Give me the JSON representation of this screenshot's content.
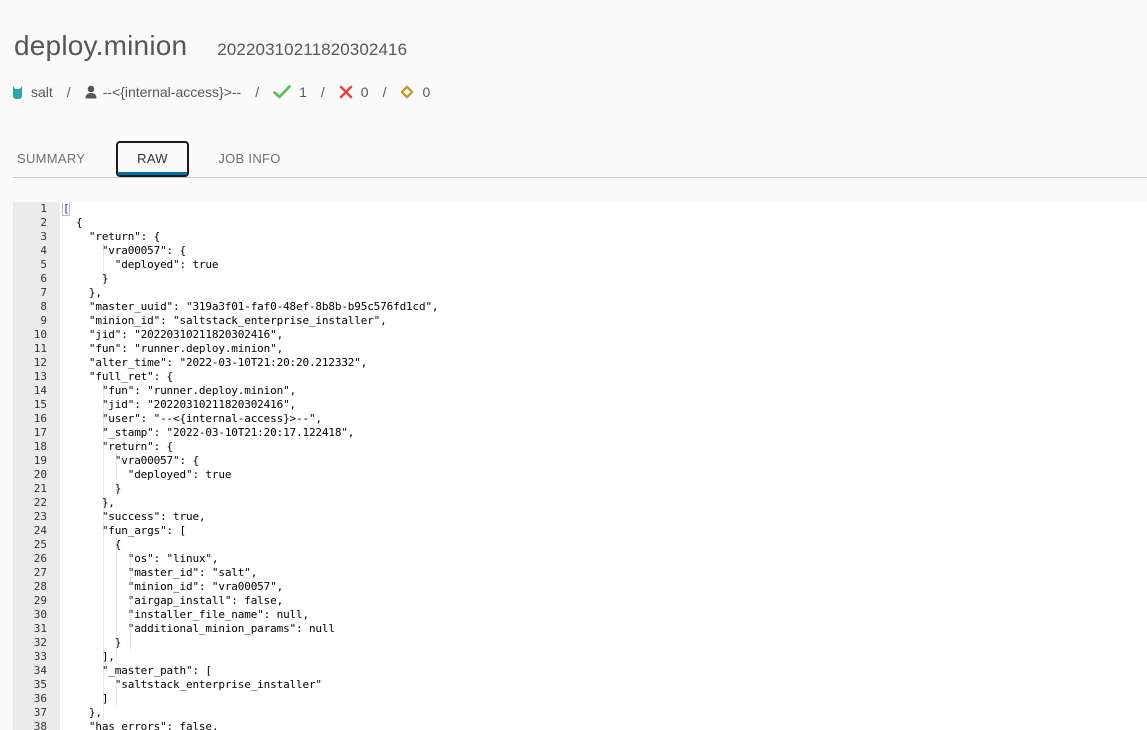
{
  "header": {
    "title": "deploy.minion",
    "jid": "20220310211820302416"
  },
  "meta": {
    "master": {
      "icon": "salt-master-icon",
      "label": "salt",
      "color": "#2ba5a5"
    },
    "user": {
      "icon": "user-icon",
      "label": "--<{internal-access}>--"
    },
    "succeeded": {
      "icon": "check-icon",
      "count": "1",
      "color": "#5fb760"
    },
    "failed": {
      "icon": "x-icon",
      "count": "0",
      "color": "#e34545"
    },
    "other": {
      "icon": "diamond-icon",
      "count": "0",
      "color": "#c6941f"
    },
    "separator": "/"
  },
  "tabs": [
    {
      "label": "SUMMARY",
      "active": false
    },
    {
      "label": "RAW",
      "active": true
    },
    {
      "label": "JOB INFO",
      "active": false
    }
  ],
  "accent_color": "#0072a3",
  "editor": {
    "lines": [
      "[",
      "  {",
      "    \"return\": {",
      "      \"vra00057\": {",
      "        \"deployed\": true",
      "      }",
      "    },",
      "    \"master_uuid\": \"319a3f01-faf0-48ef-8b8b-b95c576fd1cd\",",
      "    \"minion_id\": \"saltstack_enterprise_installer\",",
      "    \"jid\": \"20220310211820302416\",",
      "    \"fun\": \"runner.deploy.minion\",",
      "    \"alter_time\": \"2022-03-10T21:20:20.212332\",",
      "    \"full_ret\": {",
      "      \"fun\": \"runner.deploy.minion\",",
      "      \"jid\": \"20220310211820302416\",",
      "      \"user\": \"--<{internal-access}>--\",",
      "      \"_stamp\": \"2022-03-10T21:20:17.122418\",",
      "      \"return\": {",
      "        \"vra00057\": {",
      "          \"deployed\": true",
      "        }",
      "      },",
      "      \"success\": true,",
      "      \"fun_args\": [",
      "        {",
      "          \"os\": \"linux\",",
      "          \"master_id\": \"salt\",",
      "          \"minion_id\": \"vra00057\",",
      "          \"airgap_install\": false,",
      "          \"installer_file_name\": null,",
      "          \"additional_minion_params\": null",
      "        }",
      "      ],",
      "      \"_master_path\": [",
      "        \"saltstack_enterprise_installer\"",
      "      ]",
      "    },",
      "    \"has_errors\": false,"
    ]
  }
}
